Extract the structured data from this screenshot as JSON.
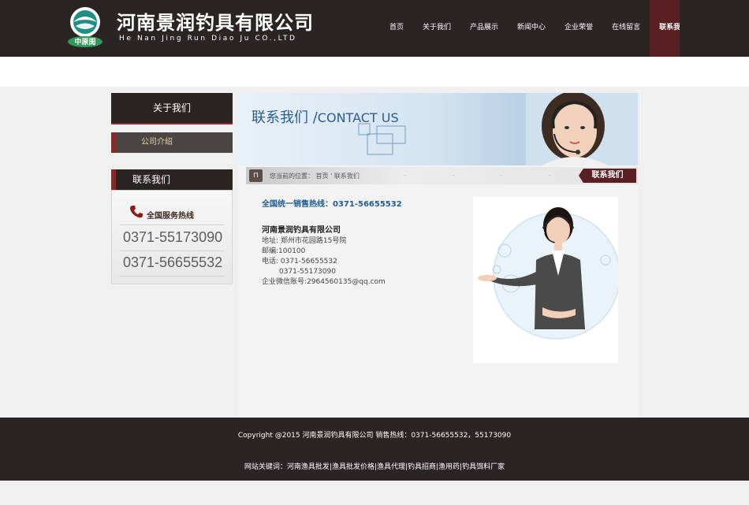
{
  "header": {
    "logo_text": "中原闺",
    "brand_title": "河南景润钓具有限公司",
    "brand_subtitle": "He Nan Jing Run Diao Ju CO.,LTD",
    "nav": [
      {
        "label": "首页"
      },
      {
        "label": "关于我们"
      },
      {
        "label": "产品展示"
      },
      {
        "label": "新闻中心"
      },
      {
        "label": "企业荣誉"
      },
      {
        "label": "在线留言"
      },
      {
        "label": "联系我们",
        "active": true
      }
    ]
  },
  "sidebar": {
    "section_title": "关于我们",
    "items": [
      {
        "label": "公司介绍"
      }
    ],
    "contact_title": "联系我们",
    "hotline_label": "全国服务热线",
    "hotline_numbers": [
      "0371-55173090",
      "0371-56655532"
    ]
  },
  "main": {
    "banner_cn": "联系我们",
    "banner_sep": " /",
    "banner_en": "CONTACT US",
    "breadcrumb": {
      "prefix": "您当前的位置：",
      "home": "首页",
      "separator": "'",
      "current": "联系我们"
    },
    "section_tab": "联系我们",
    "sales_hotline": "全国统一销售热线：0371-56655532",
    "company_name": "河南景润钓具有限公司",
    "address": "地址: 郑州市花园路15号院",
    "postcode": "邮编:100100",
    "phone_label": "电话: 0371-56655532",
    "phone_second": "0371-55173090",
    "wechat": "企业微信账号:2964560135@qq.com"
  },
  "footer": {
    "copyright": "Copyright @2015 河南景润钓具有限公司 销售热线：0371-56655532，55173090",
    "keywords": "网站关键词：河南渔具批发|渔具批发价格|渔具代理|钓具招商|渔用药|钓具饵料厂家"
  },
  "colors": {
    "header_bg": "#2a2523",
    "accent": "#5a1f22",
    "link_blue": "#1e5c92"
  }
}
